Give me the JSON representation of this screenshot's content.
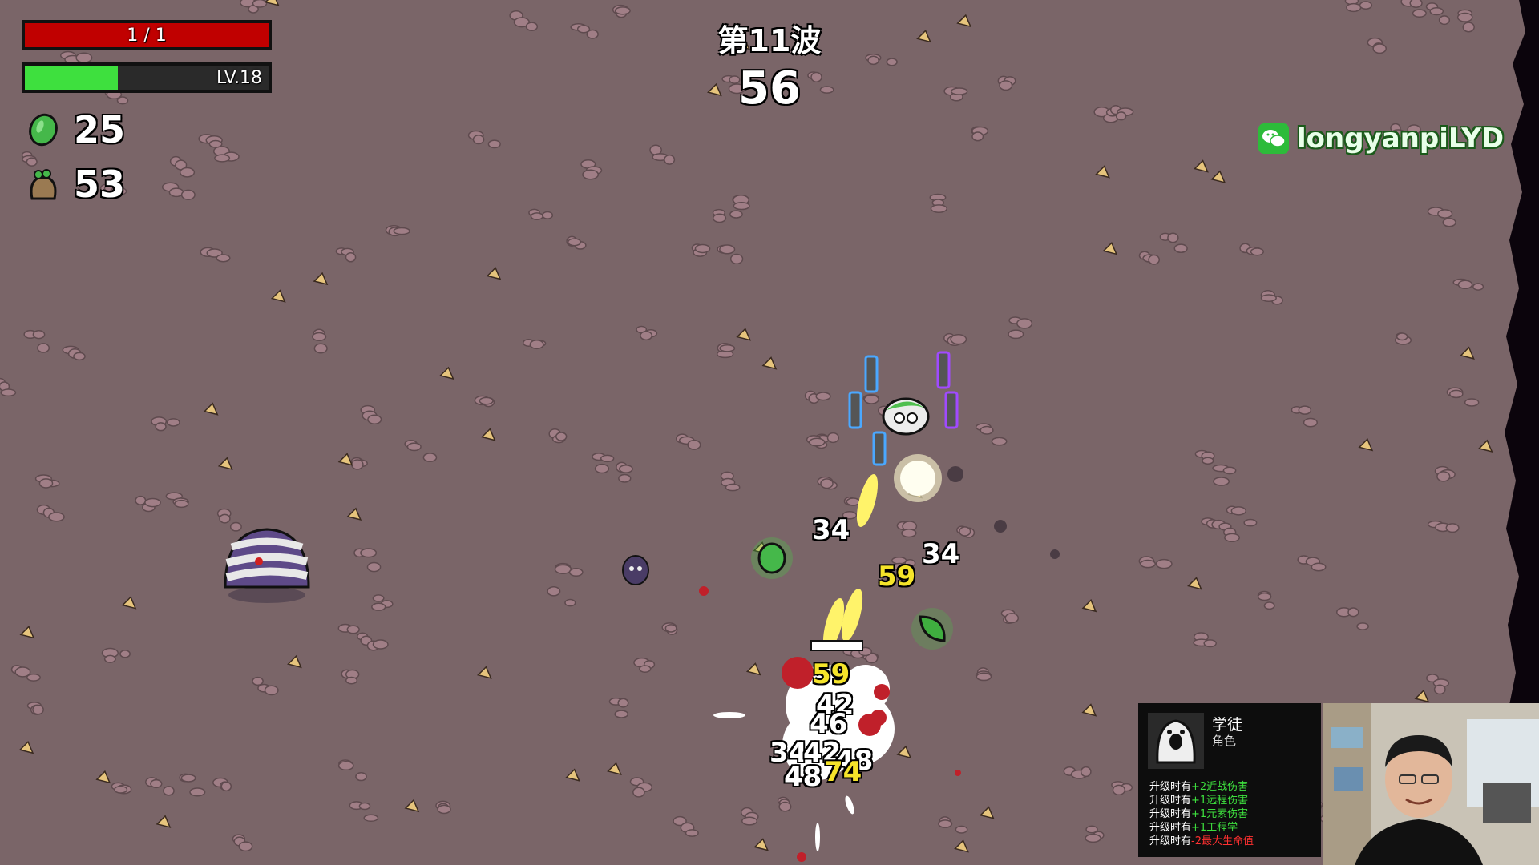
{
  "hud": {
    "health": {
      "text": "1 / 1",
      "current": 1,
      "max": 1,
      "color": "#c00000"
    },
    "xp": {
      "level_text": "LV.18",
      "progress": 0.38,
      "color": "#3ee03e"
    },
    "materials": {
      "value": "25",
      "icon": "green-material-icon"
    },
    "bag": {
      "value": "53",
      "icon": "material-bag-icon"
    }
  },
  "wave": {
    "title": "第11波",
    "timer": "56"
  },
  "damage_numbers": [
    {
      "text": "34",
      "color": "#ffffff"
    },
    {
      "text": "34",
      "color": "#ffffff"
    },
    {
      "text": "59",
      "color": "#f5e42a"
    },
    {
      "text": "59",
      "color": "#f5e42a"
    },
    {
      "text": "42",
      "color": "#ffffff"
    },
    {
      "text": "46",
      "color": "#ffffff"
    },
    {
      "text": "34",
      "color": "#ffffff"
    },
    {
      "text": "42",
      "color": "#ffffff"
    },
    {
      "text": "48",
      "color": "#ffffff"
    },
    {
      "text": "48",
      "color": "#ffffff"
    },
    {
      "text": "74",
      "color": "#f5e42a"
    }
  ],
  "overlay": {
    "wechat_handle": "longyanpiLYD",
    "wechat_icon": "wechat-icon"
  },
  "character_card": {
    "name": "学徒",
    "type": "角色",
    "portrait_icon": "apprentice-ghost-icon",
    "bonuses": [
      {
        "prefix": "升级时有",
        "effect": "+2近战伤害",
        "color": "#3ee03e"
      },
      {
        "prefix": "升级时有",
        "effect": "+1远程伤害",
        "color": "#3ee03e"
      },
      {
        "prefix": "升级时有",
        "effect": "+1元素伤害",
        "color": "#3ee03e"
      },
      {
        "prefix": "升级时有",
        "effect": "+1工程学",
        "color": "#3ee03e"
      },
      {
        "prefix": "升级时有",
        "effect": "-2最大生命值",
        "color": "#ff3030"
      }
    ]
  },
  "colors": {
    "ground": "#7a6568",
    "pebble": "#a07e86",
    "leaf": "#e6c47c",
    "projectile": "#fffb8a"
  }
}
